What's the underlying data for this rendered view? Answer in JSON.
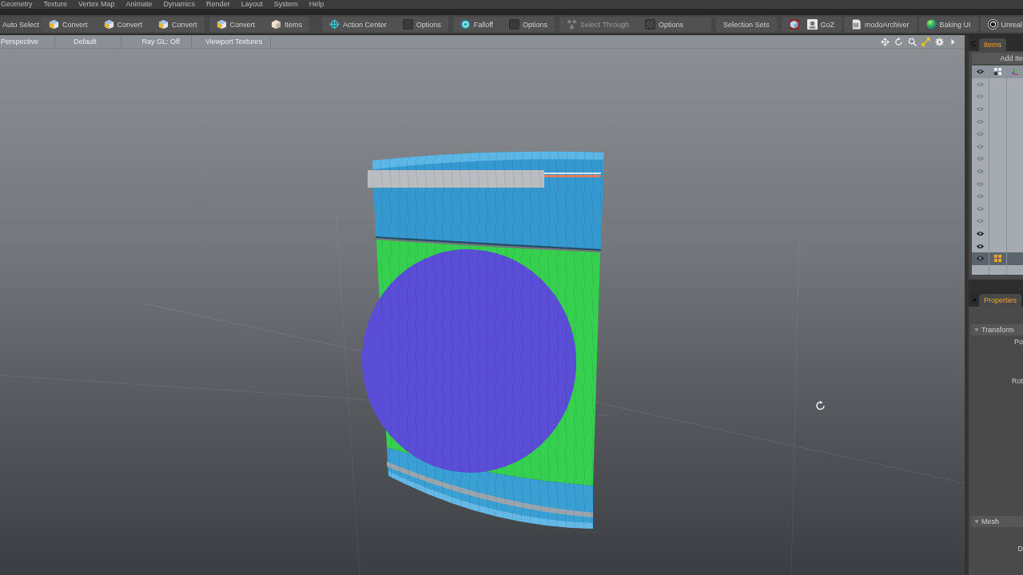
{
  "menu_bar": {
    "items": [
      "Geometry",
      "Texture",
      "Vertex Map",
      "Animate",
      "Dynamics",
      "Render",
      "Layout",
      "System",
      "Help"
    ]
  },
  "toolbar": {
    "groups": [
      {
        "items": [
          {
            "label": "Auto Select",
            "kind": "text",
            "disabled": false
          }
        ]
      },
      {
        "items": [
          {
            "label": "Convert",
            "kind": "cube",
            "disabled": false
          },
          {
            "label": "Convert",
            "kind": "cube",
            "disabled": false
          },
          {
            "label": "Convert",
            "kind": "cube",
            "disabled": false
          }
        ]
      },
      {
        "items": [
          {
            "label": "Convert",
            "kind": "cube",
            "disabled": false
          },
          {
            "label": "Items",
            "kind": "box",
            "disabled": false
          }
        ]
      },
      {
        "items": [
          {
            "label": "Action Center",
            "kind": "target",
            "disabled": false
          },
          {
            "label": "Options",
            "kind": "square",
            "disabled": false
          }
        ]
      },
      {
        "items": [
          {
            "label": "Falloff",
            "kind": "ring",
            "disabled": false
          },
          {
            "label": "Options",
            "kind": "square",
            "disabled": false
          }
        ]
      },
      {
        "items": [
          {
            "label": "Select Through",
            "kind": "dots",
            "disabled": true
          },
          {
            "label": "Options",
            "kind": "hatched",
            "disabled": false
          }
        ]
      },
      {
        "items": [
          {
            "label": "Selection Sets",
            "kind": "text",
            "disabled": false
          }
        ]
      },
      {
        "items": [
          {
            "kind": "bluecube",
            "disabled": false
          },
          {
            "label": "GoZ",
            "kind": "picture",
            "disabled": false
          }
        ]
      },
      {
        "items": [
          {
            "label": "modoArchiver",
            "kind": "document",
            "disabled": false
          }
        ]
      },
      {
        "items": [
          {
            "label": "Baking UI",
            "kind": "sphere",
            "disabled": false
          }
        ]
      },
      {
        "items": [
          {
            "label": "Unreal",
            "kind": "logo",
            "disabled": false
          }
        ]
      }
    ]
  },
  "viewport": {
    "header": [
      "Perspective",
      "Default",
      "Ray GL: Off",
      "Viewport Textures"
    ]
  },
  "items_panel": {
    "tabs": [
      {
        "label": "Items",
        "selected": true
      }
    ],
    "add_button": "Add Ite",
    "rows": [
      {
        "visible": false,
        "selected": false,
        "kind": "plain"
      },
      {
        "visible": false,
        "selected": false,
        "kind": "plain"
      },
      {
        "visible": false,
        "selected": false,
        "kind": "plain"
      },
      {
        "visible": false,
        "selected": false,
        "kind": "plain"
      },
      {
        "visible": false,
        "selected": false,
        "kind": "plain"
      },
      {
        "visible": false,
        "selected": false,
        "kind": "plain"
      },
      {
        "visible": false,
        "selected": false,
        "kind": "plain"
      },
      {
        "visible": false,
        "selected": false,
        "kind": "plain"
      },
      {
        "visible": false,
        "selected": false,
        "kind": "plain"
      },
      {
        "visible": false,
        "selected": false,
        "kind": "plain"
      },
      {
        "visible": false,
        "selected": false,
        "kind": "plain"
      },
      {
        "visible": false,
        "selected": false,
        "kind": "plain"
      },
      {
        "visible": true,
        "selected": false,
        "kind": "plain"
      },
      {
        "visible": true,
        "selected": false,
        "kind": "plain"
      },
      {
        "visible": true,
        "selected": true,
        "kind": "group"
      }
    ]
  },
  "properties_panel": {
    "tabs": [
      {
        "label": "Properties",
        "selected": true
      }
    ],
    "sections": [
      {
        "title": "Transform",
        "expanded": true,
        "fields": [
          "Po",
          "Rot"
        ]
      },
      {
        "title": "Mesh",
        "expanded": true,
        "fields": [
          "D"
        ]
      }
    ]
  }
}
